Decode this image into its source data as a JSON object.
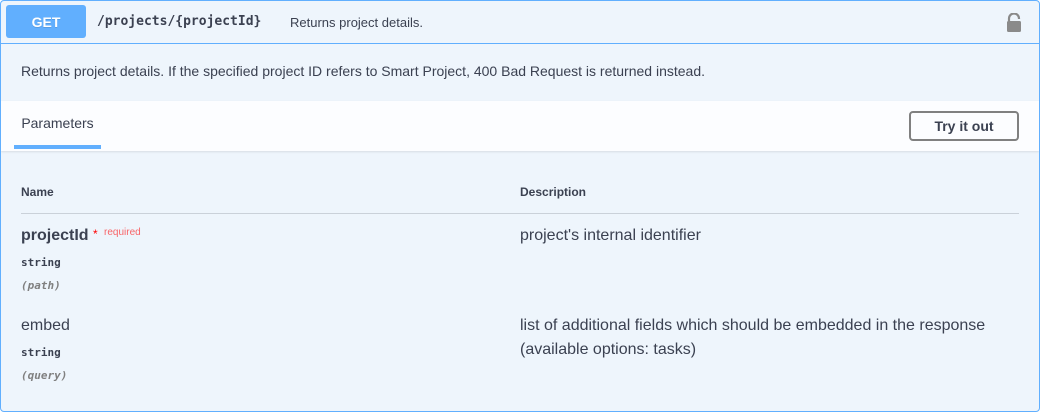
{
  "operation": {
    "method": "GET",
    "path": "/projects/{projectId}",
    "summary": "Returns project details.",
    "description": "Returns project details. If the specified project ID refers to Smart Project, 400 Bad Request is returned instead.",
    "lock_icon": "lock-icon"
  },
  "section": {
    "tab_label": "Parameters",
    "try_label": "Try it out"
  },
  "table": {
    "name_header": "Name",
    "description_header": "Description"
  },
  "parameters": [
    {
      "name": "projectId",
      "required_star": "*",
      "required_label": "required",
      "type": "string",
      "in": "(path)",
      "description": "project's internal identifier"
    },
    {
      "name": "embed",
      "type": "string",
      "in": "(query)",
      "description": "list of additional fields which should be embedded in the response",
      "description_line2": "(available options: tasks)"
    }
  ],
  "colors": {
    "accent": "#61affe",
    "background": "#eef5fc",
    "required": "#ff0000"
  }
}
